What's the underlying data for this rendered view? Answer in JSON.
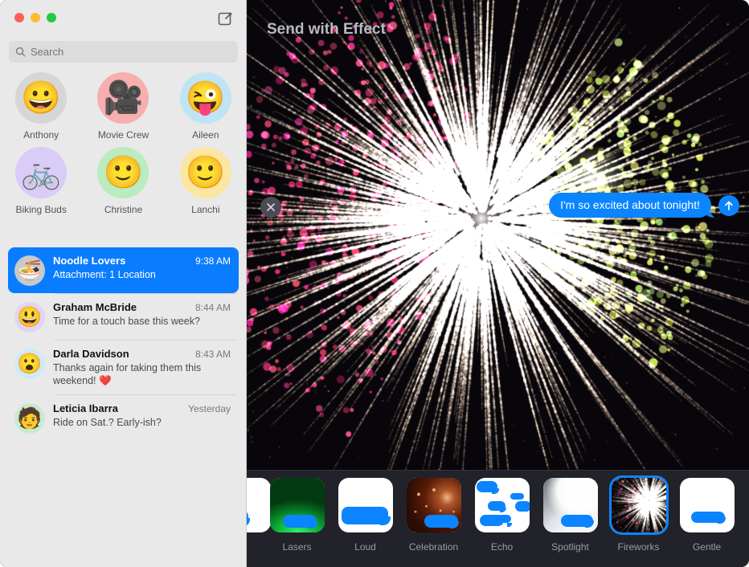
{
  "window": {
    "traffic_lights": [
      {
        "name": "close",
        "color": "#ff5f57"
      },
      {
        "name": "minimize",
        "color": "#febc2e"
      },
      {
        "name": "maximize",
        "color": "#28c840"
      }
    ],
    "compose_icon": "compose-icon"
  },
  "search": {
    "placeholder": "Search",
    "value": "",
    "icon": "search-icon"
  },
  "pinned": [
    {
      "label": "Anthony",
      "glyph": "😀",
      "bg": "#d6d6d6",
      "icon": "memoji-anthony"
    },
    {
      "label": "Movie Crew",
      "glyph": "🎥",
      "bg": "#f7aeae",
      "icon": "movie-camera"
    },
    {
      "label": "Aileen",
      "glyph": "😜",
      "bg": "#bfe4f5",
      "icon": "memoji-aileen"
    },
    {
      "label": "Biking Buds",
      "glyph": "🚲",
      "bg": "#d9ccf7",
      "icon": "bicycle"
    },
    {
      "label": "Christine",
      "glyph": "🙂",
      "bg": "#b9ecbe",
      "icon": "memoji-christine"
    },
    {
      "label": "Lanchi",
      "glyph": "🙂",
      "bg": "#fbe6a2",
      "icon": "memoji-lanchi"
    }
  ],
  "conversations": [
    {
      "name": "Noodle Lovers",
      "time": "9:38 AM",
      "preview": "Attachment: 1 Location",
      "selected": true,
      "avatar_glyph": "🍜",
      "avatar_bg": "#c9c9c9"
    },
    {
      "name": "Graham McBride",
      "time": "8:44 AM",
      "preview": "Time for a touch base this week?",
      "selected": false,
      "avatar_glyph": "😃",
      "avatar_bg": "#e2d4f7"
    },
    {
      "name": "Darla Davidson",
      "time": "8:43 AM",
      "preview": "Thanks again for taking them this weekend! ❤️",
      "selected": false,
      "avatar_glyph": "😮",
      "avatar_bg": "#cfeaf8"
    },
    {
      "name": "Leticia Ibarra",
      "time": "Yesterday",
      "preview": "Ride on Sat.? Early-ish?",
      "selected": false,
      "avatar_glyph": "🧑",
      "avatar_bg": "#c6eccd"
    }
  ],
  "panel": {
    "title": "Send with Effect",
    "cancel_icon": "close-icon",
    "send_icon": "send-arrow-up-icon",
    "accent": "#0b84ff",
    "background": "#22222a",
    "preview_background": "#08060a"
  },
  "message": {
    "text": "I'm so excited about tonight!",
    "bubble_color": "#0b84ff"
  },
  "effects": [
    {
      "label": "",
      "style": "invisible-ink",
      "selected": false,
      "partial": true
    },
    {
      "label": "Lasers",
      "style": "lasers",
      "selected": false
    },
    {
      "label": "Loud",
      "style": "loud",
      "selected": false
    },
    {
      "label": "Celebration",
      "style": "celebration",
      "selected": false
    },
    {
      "label": "Echo",
      "style": "echo",
      "selected": false
    },
    {
      "label": "Spotlight",
      "style": "spotlight",
      "selected": false
    },
    {
      "label": "Fireworks",
      "style": "fireworks",
      "selected": true
    },
    {
      "label": "Gentle",
      "style": "gentle",
      "selected": false
    }
  ]
}
